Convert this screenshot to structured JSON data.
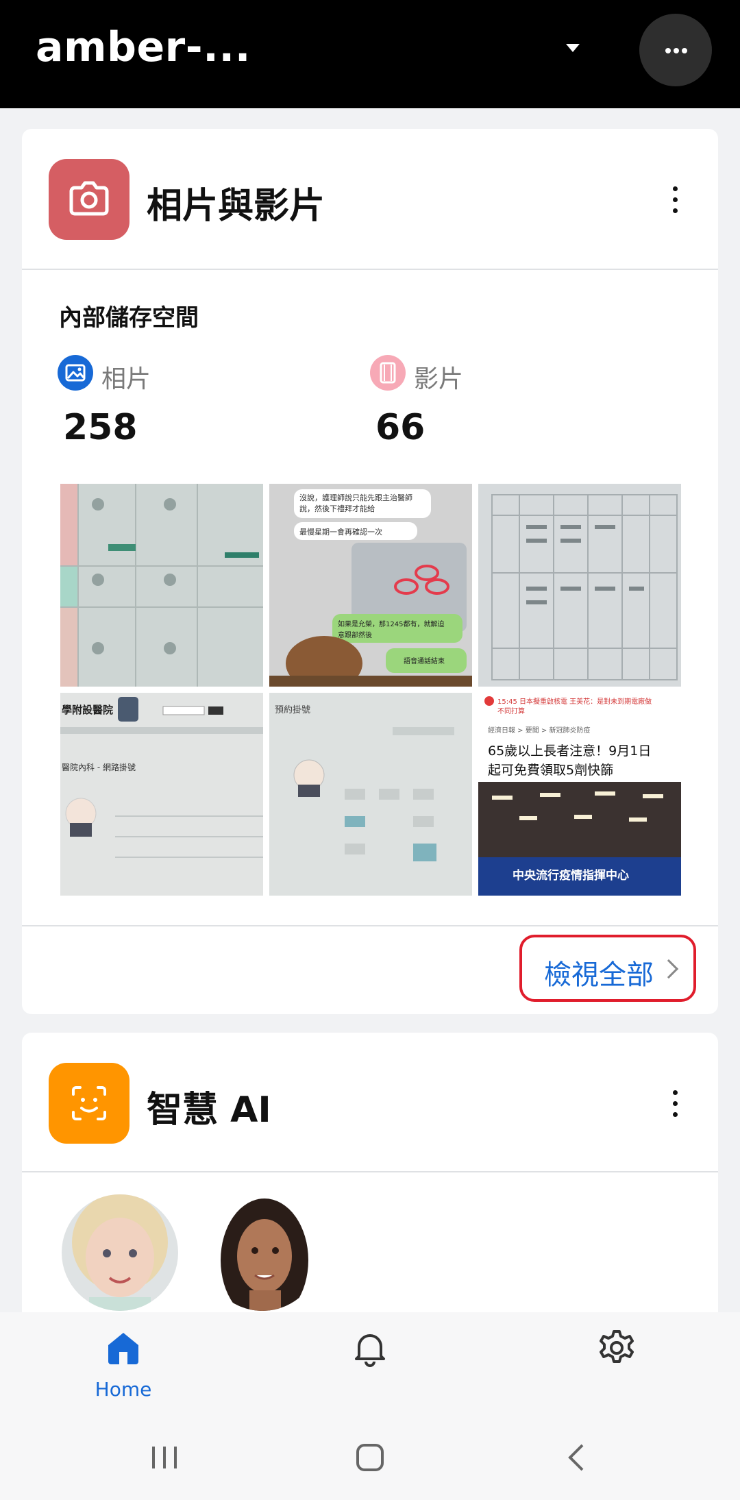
{
  "header": {
    "title": "amber-..."
  },
  "photos_card": {
    "title": "相片與影片",
    "section_label": "內部儲存空間",
    "photos": {
      "label": "相片",
      "count": "258"
    },
    "videos": {
      "label": "影片",
      "count": "66"
    },
    "thumbnails": [
      {
        "caption": ""
      },
      {
        "lines": [
          "沒說，護理師說只能先跟主治醫師",
          "說，然後下禮拜才能給",
          "最慢星期一會再確認一次",
          "如果是允榮，那1245都有，就解迫",
          "意跟部然後",
          "語音通話結束"
        ]
      },
      {
        "caption": ""
      },
      {
        "lines": [
          "學附設醫院",
          "醫院內科 - 網路掛號"
        ]
      },
      {
        "lines": [
          "預約掛號"
        ]
      },
      {
        "lines": [
          "15:45 日本擬重啟核電 王美花：是對未到期電廠做",
          "不同打算",
          "經濟日報 > 要聞 > 新冠肺炎防疫",
          "65歲以上長者注意！9月1日",
          "起可免費領取5劑快篩",
          "中央流行疫情指揮中心"
        ]
      }
    ],
    "view_all_label": "檢視全部"
  },
  "ai_card": {
    "title": "智慧 AI"
  },
  "bottom_nav": {
    "home_label": "Home"
  },
  "colors": {
    "accent": "#1769d6",
    "highlight_box": "#e01d2c",
    "photos_icon": "#d55e63",
    "ai_icon": "#ff9500"
  }
}
